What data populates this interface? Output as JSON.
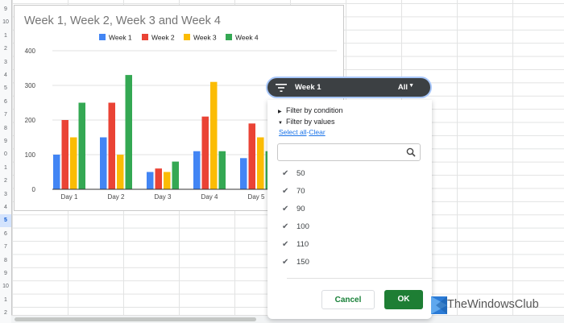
{
  "sheet": {
    "row_numbers": [
      "9",
      "10",
      "1",
      "2",
      "3",
      "4",
      "5",
      "6",
      "7",
      "8",
      "9",
      "0",
      "1",
      "2",
      "3",
      "4",
      "5",
      "6",
      "7",
      "8",
      "9",
      "10",
      "1",
      "2"
    ],
    "active_row_index": 16
  },
  "chart_data": {
    "type": "bar",
    "title": "Week 1, Week 2, Week 3 and Week 4",
    "categories": [
      "Day 1",
      "Day 2",
      "Day 3",
      "Day 4",
      "Day 5"
    ],
    "series": [
      {
        "name": "Week 1",
        "color": "#4285f4",
        "values": [
          100,
          150,
          50,
          110,
          90
        ]
      },
      {
        "name": "Week 2",
        "color": "#ea4335",
        "values": [
          200,
          250,
          60,
          210,
          190
        ]
      },
      {
        "name": "Week 3",
        "color": "#fbbc04",
        "values": [
          150,
          100,
          50,
          310,
          150
        ]
      },
      {
        "name": "Week 4",
        "color": "#34a853",
        "values": [
          250,
          330,
          80,
          110,
          110
        ]
      }
    ],
    "yticks": [
      "0",
      "100",
      "200",
      "300",
      "400"
    ],
    "ylim": [
      0,
      400
    ],
    "grid": true,
    "legend_position": "top"
  },
  "filter": {
    "column_name": "Week 1",
    "all_label": "All",
    "filter_by_condition": "Filter by condition",
    "filter_by_values": "Filter by values",
    "select_all": "Select all",
    "separator": "-",
    "clear": "Clear",
    "search_placeholder": "",
    "values": [
      {
        "label": "50",
        "checked": true
      },
      {
        "label": "70",
        "checked": true
      },
      {
        "label": "90",
        "checked": true
      },
      {
        "label": "100",
        "checked": true
      },
      {
        "label": "110",
        "checked": true
      },
      {
        "label": "150",
        "checked": true
      }
    ],
    "cancel_label": "Cancel",
    "ok_label": "OK"
  },
  "watermark": {
    "text": "TheWindowsClub"
  }
}
